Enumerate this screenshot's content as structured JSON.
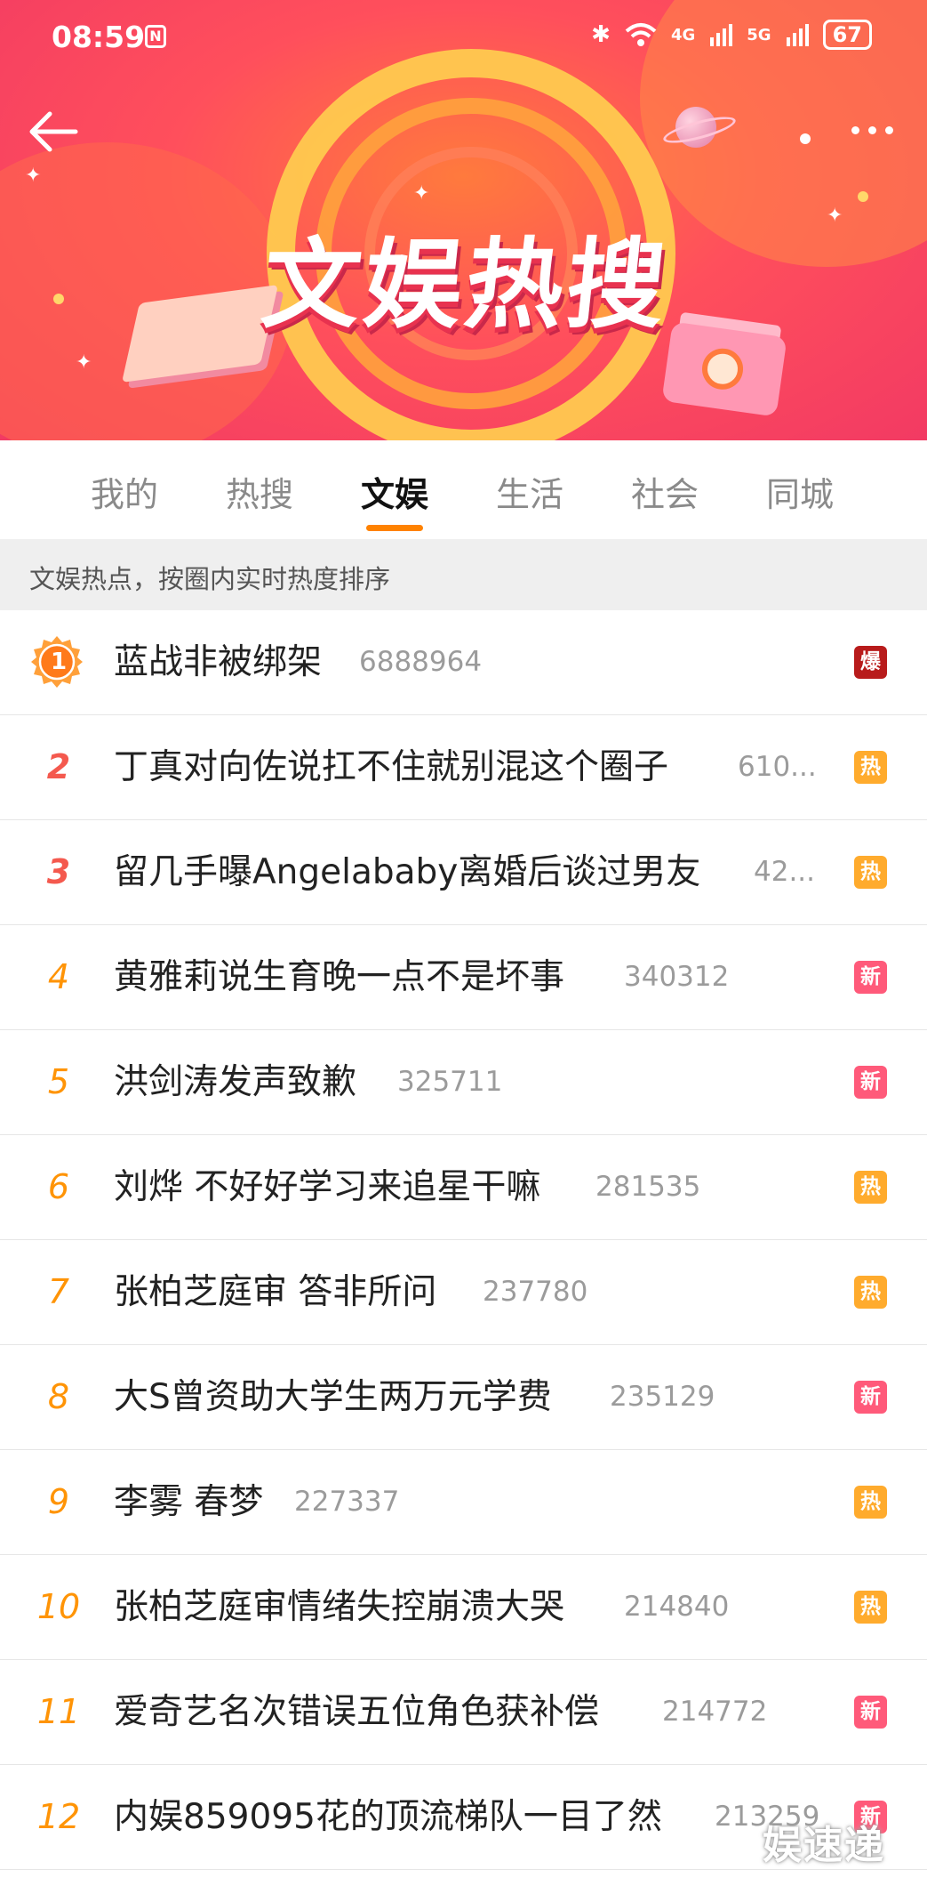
{
  "status_bar": {
    "time": "08:59",
    "nfc": "N",
    "bluetooth": "✱",
    "wifi": "WiFi",
    "net1": "4G",
    "net2": "5G",
    "battery": "67"
  },
  "banner": {
    "title": "文娱热搜"
  },
  "tabs": [
    {
      "label": "我的"
    },
    {
      "label": "热搜"
    },
    {
      "label": "文娱",
      "active": true
    },
    {
      "label": "生活"
    },
    {
      "label": "社会"
    },
    {
      "label": "同城"
    }
  ],
  "hint": "文娱热点，按圈内实时热度排序",
  "colors": {
    "accent": "#ff8200",
    "badge_bao": "#b81b1b",
    "badge_hot": "#ffab2d",
    "badge_new": "#ff5a7a"
  },
  "items": [
    {
      "rank": "1",
      "title": "蓝战非被绑架",
      "count": "6888964",
      "badge": "爆",
      "badge_type": "bao"
    },
    {
      "rank": "2",
      "title": "丁真对向佐说扛不住就别混这个圈子",
      "count": "610...",
      "badge": "热",
      "badge_type": "hot"
    },
    {
      "rank": "3",
      "title": "留几手曝Angelababy离婚后谈过男友",
      "count": "42...",
      "badge": "热",
      "badge_type": "hot"
    },
    {
      "rank": "4",
      "title": "黄雅莉说生育晚一点不是坏事",
      "count": "340312",
      "badge": "新",
      "badge_type": "new"
    },
    {
      "rank": "5",
      "title": "洪剑涛发声致歉",
      "count": "325711",
      "badge": "新",
      "badge_type": "new"
    },
    {
      "rank": "6",
      "title": "刘烨 不好好学习来追星干嘛",
      "count": "281535",
      "badge": "热",
      "badge_type": "hot"
    },
    {
      "rank": "7",
      "title": "张柏芝庭审 答非所问",
      "count": "237780",
      "badge": "热",
      "badge_type": "hot"
    },
    {
      "rank": "8",
      "title": "大S曾资助大学生两万元学费",
      "count": "235129",
      "badge": "新",
      "badge_type": "new"
    },
    {
      "rank": "9",
      "title": "李雾 春梦",
      "count": "227337",
      "badge": "热",
      "badge_type": "hot"
    },
    {
      "rank": "10",
      "title": "张柏芝庭审情绪失控崩溃大哭",
      "count": "214840",
      "badge": "热",
      "badge_type": "hot"
    },
    {
      "rank": "11",
      "title": "爱奇艺名次错误五位角色获补偿",
      "count": "214772",
      "badge": "新",
      "badge_type": "new"
    },
    {
      "rank": "12",
      "title": "内娱859095花的顶流梯队一目了然",
      "count": "213259",
      "badge": "新",
      "badge_type": "new"
    }
  ],
  "watermark": "娱速递"
}
